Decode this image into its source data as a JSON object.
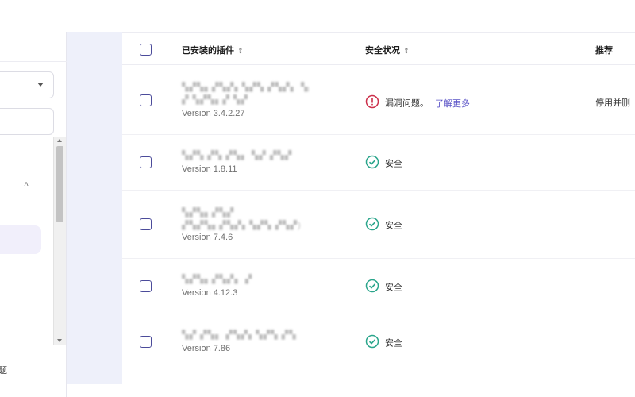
{
  "sidebar": {
    "bottom_label": "题"
  },
  "table": {
    "headers": {
      "plugin": "已安装的插件",
      "security": "安全状况",
      "recommend": "推荐"
    },
    "rows": [
      {
        "name": "▚▞▚▖▞▚▞▖▚▞▚ ▞▚▞▖ ▚▞▚ &",
        "name2": "▞ ▚▞▚▖▞ ▚▞",
        "version": "Version 3.4.2.27",
        "status": "漏洞问题。",
        "link": "了解更多",
        "status_icon": "warning-circle-icon",
        "recommend": "停用并删"
      },
      {
        "name": "▚▞▚ ▞▚ ▞▚▖ ▚▞ ▞▚▞",
        "version": "Version 1.8.11",
        "status": "安全",
        "status_icon": "check-circle-icon",
        "recommend": ""
      },
      {
        "name": "▚▞▚▖▞▚▞",
        "name2": "▞▚▞▚▖▞▚▞▖▚▞▚ ▞▚▞)",
        "version": "Version 7.4.6",
        "status": "安全",
        "status_icon": "check-circle-icon",
        "recommend": ""
      },
      {
        "name": "▚▞▚▖▞▚▞▖ ▞",
        "version": "Version 4.12.3",
        "status": "安全",
        "status_icon": "check-circle-icon",
        "recommend": ""
      },
      {
        "name": "▚▞ ▞▚▖ ▞▚▞▖▚▞▚ ▞▚",
        "version": "Version 7.86",
        "status": "安全",
        "status_icon": "check-circle-icon",
        "recommend": ""
      }
    ]
  },
  "colors": {
    "checkbox": "#4b4b9a",
    "safe": "#2aa58b",
    "warning": "#cc2f4a",
    "link": "#5b54c7",
    "gutter": "#eef0fa"
  }
}
